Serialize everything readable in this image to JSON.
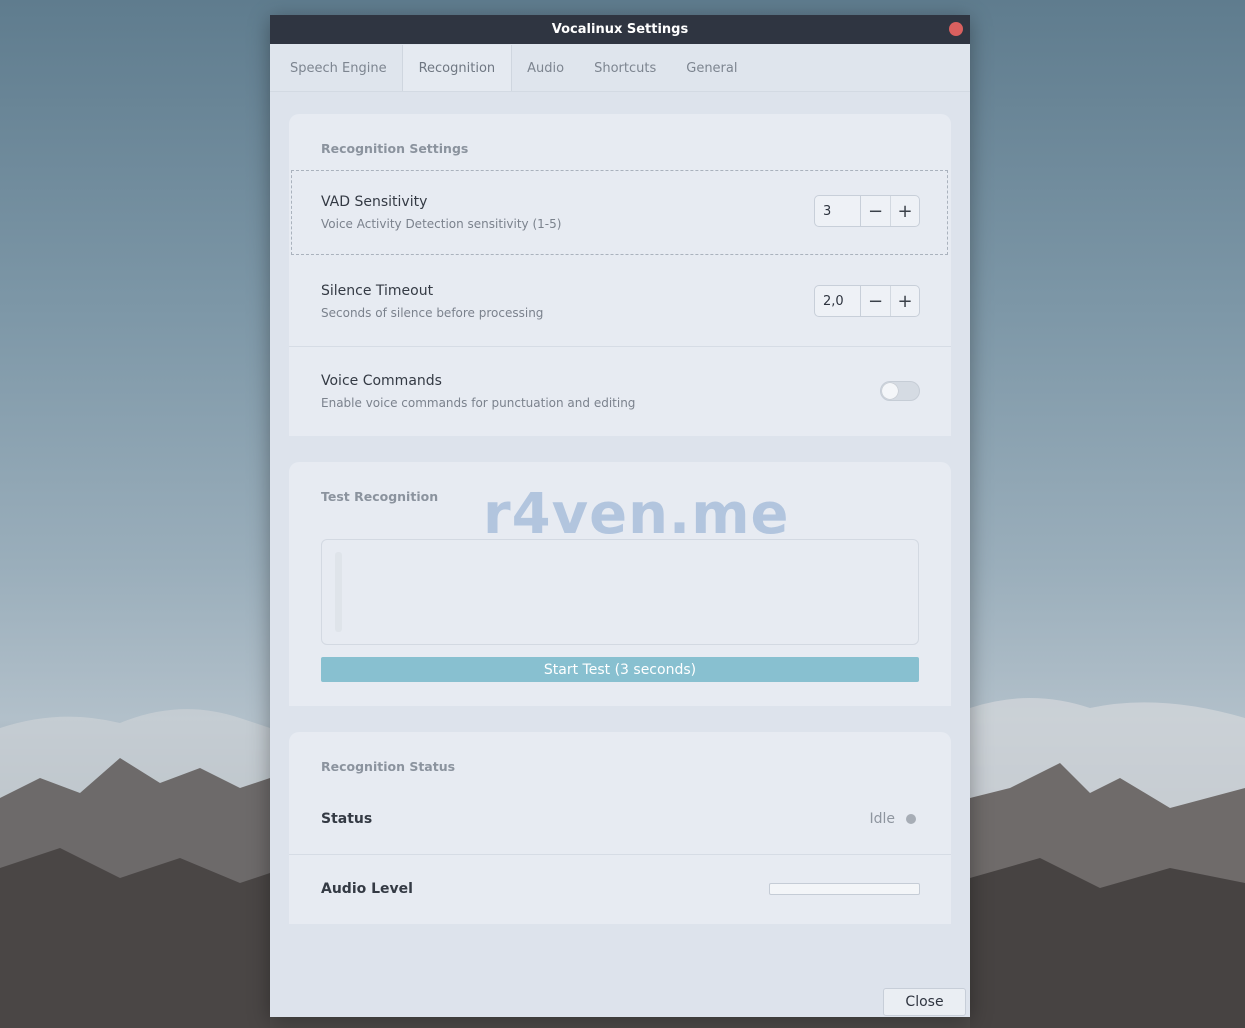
{
  "window": {
    "title": "Vocalinux Settings"
  },
  "tabs": [
    {
      "label": "Speech Engine"
    },
    {
      "label": "Recognition"
    },
    {
      "label": "Audio"
    },
    {
      "label": "Shortcuts"
    },
    {
      "label": "General"
    }
  ],
  "active_tab": "Recognition",
  "recognition_settings": {
    "title": "Recognition Settings",
    "vad": {
      "title": "VAD Sensitivity",
      "subtitle": "Voice Activity Detection sensitivity (1-5)",
      "value": "3"
    },
    "silence": {
      "title": "Silence Timeout",
      "subtitle": "Seconds of silence before processing",
      "value": "2,0"
    },
    "voice_commands": {
      "title": "Voice Commands",
      "subtitle": "Enable voice commands for punctuation and editing",
      "enabled": false
    }
  },
  "test_recognition": {
    "title": "Test Recognition",
    "start_label": "Start Test (3 seconds)"
  },
  "recognition_status": {
    "title": "Recognition Status",
    "status_label": "Status",
    "status_value": "Idle",
    "audio_level_label": "Audio Level",
    "audio_level": 0
  },
  "watermark": "r4ven.me",
  "footer": {
    "close_label": "Close"
  },
  "colors": {
    "accent": "#88c0d0",
    "titlebar": "#2f3541",
    "close_dot": "#d9605f"
  }
}
